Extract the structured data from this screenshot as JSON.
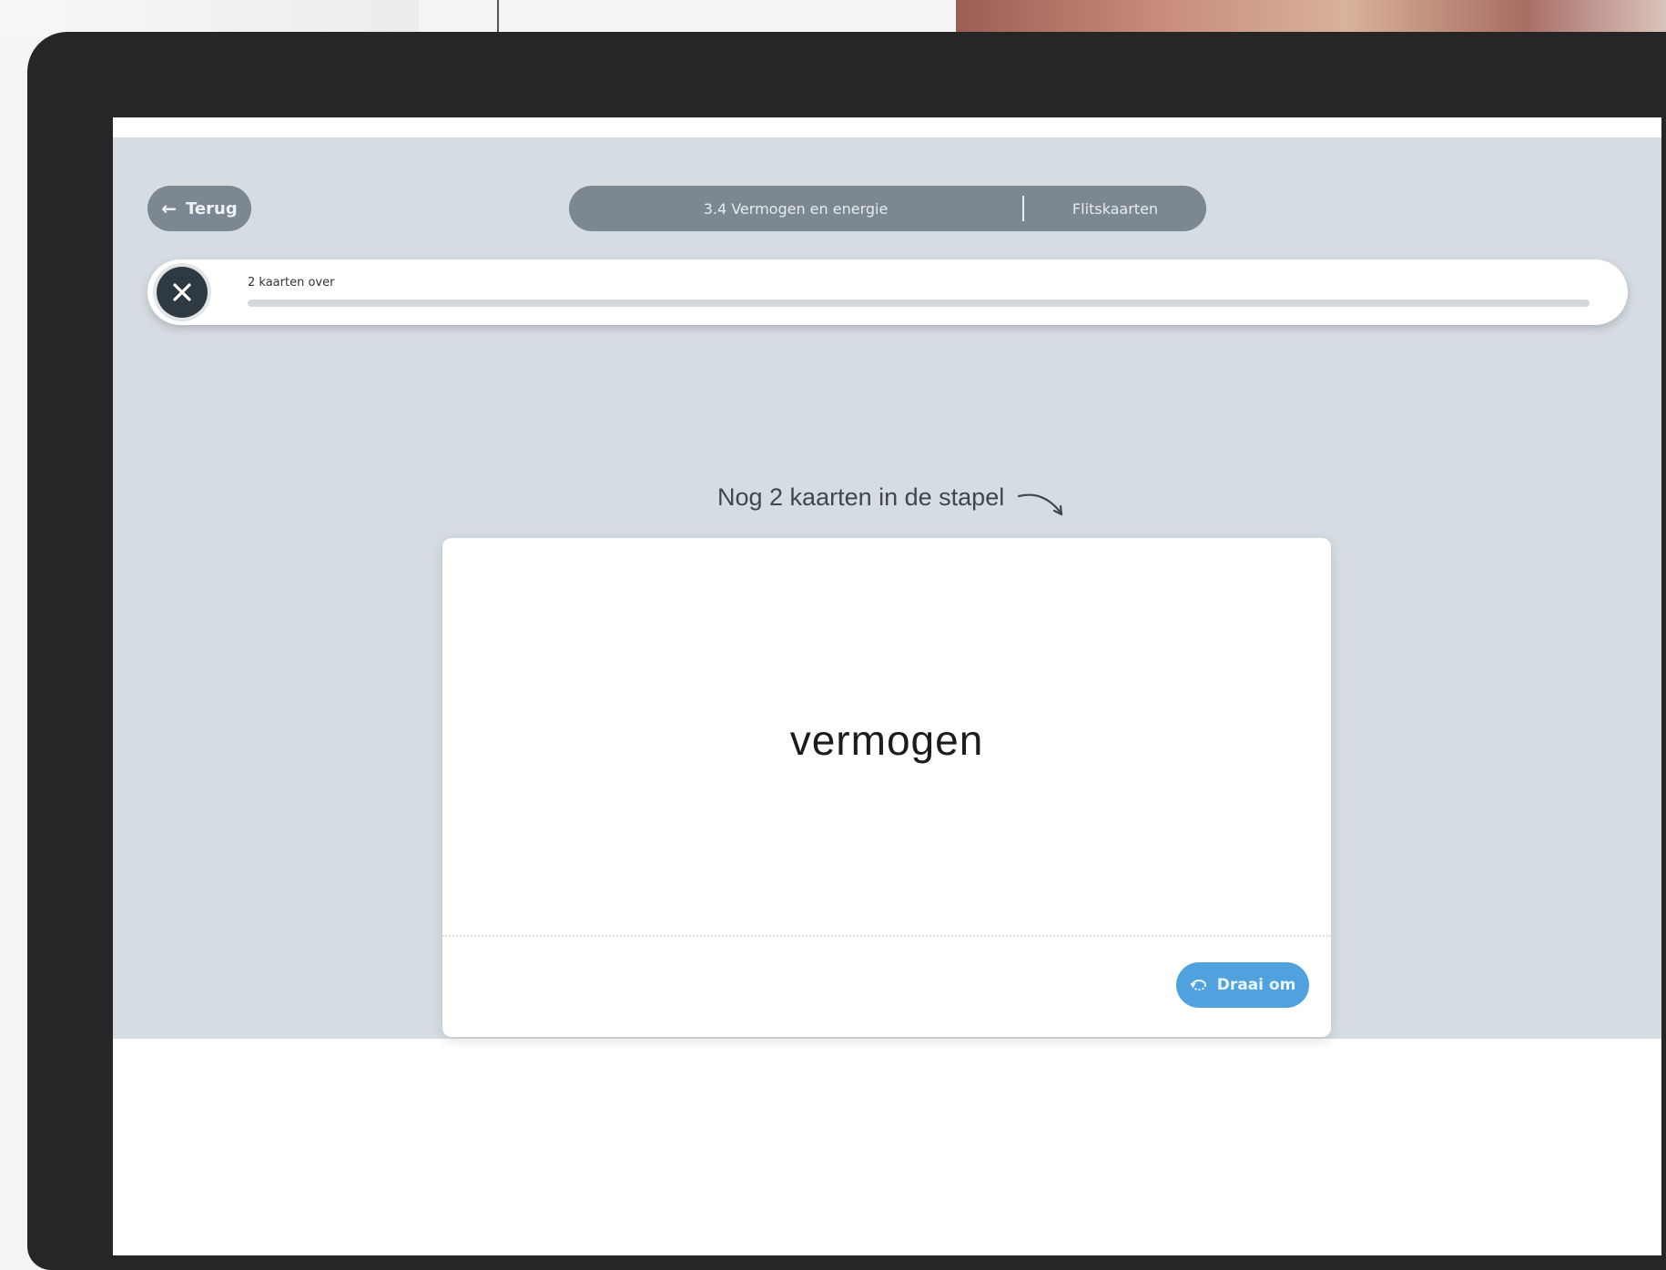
{
  "header": {
    "back_label": "Terug",
    "breadcrumb": {
      "chapter": "3.4 Vermogen en energie",
      "section": "Flitskaarten"
    }
  },
  "progress": {
    "label": "2 kaarten over",
    "fraction_done": 0
  },
  "stack_hint": "Nog 2 kaarten in de stapel",
  "card": {
    "term": "vermogen",
    "flip_label": "Draai om"
  },
  "icons": {
    "back": "arrow-left-icon",
    "close": "close-icon",
    "flip": "flip-icon",
    "hint": "curved-arrow-icon"
  },
  "colors": {
    "app_background": "#d6dde2",
    "pill": "#7c8891",
    "close_button": "#2f3942",
    "flip_button": "#4fa2de"
  }
}
